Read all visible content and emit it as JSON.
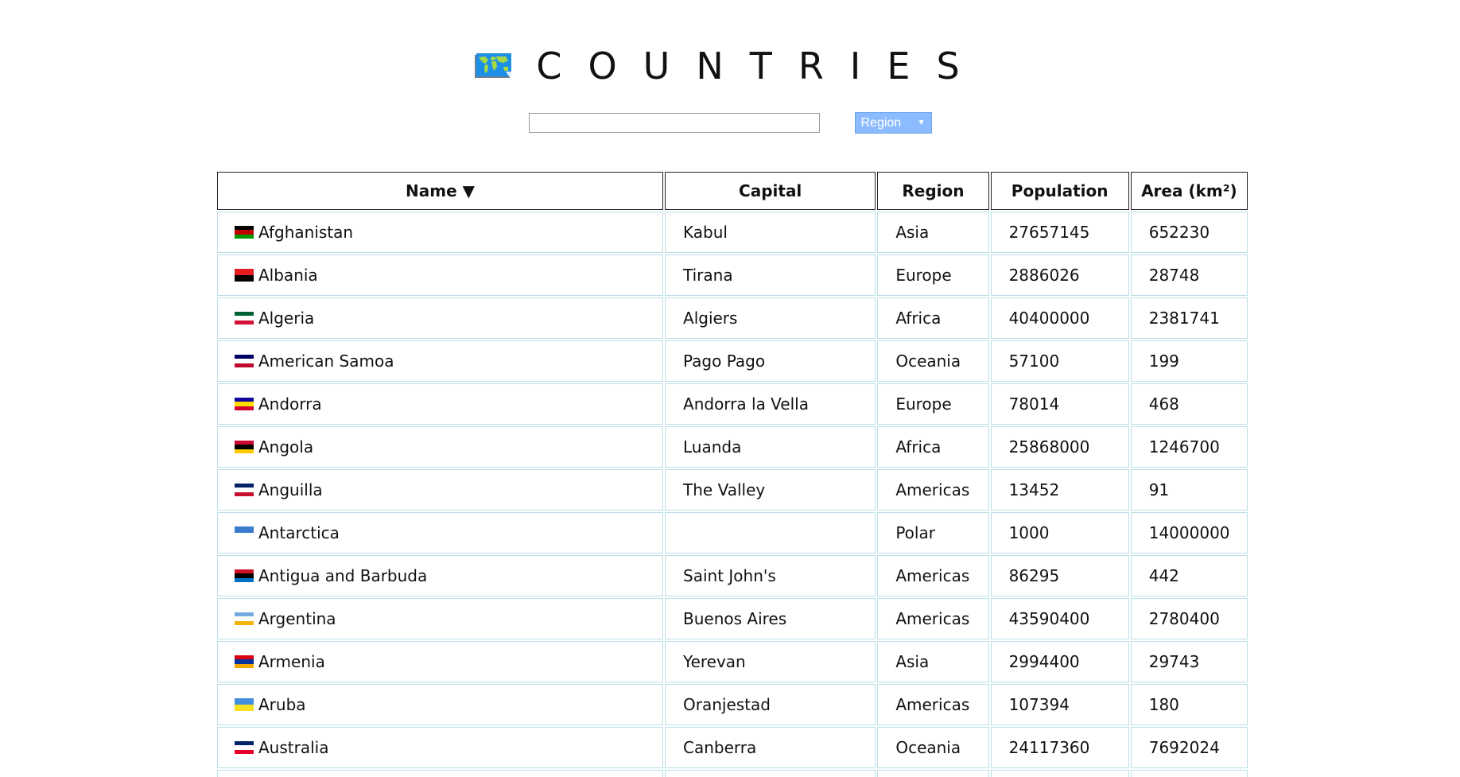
{
  "header": {
    "title": "COUNTRIES",
    "icon": "world-map-icon"
  },
  "controls": {
    "search": {
      "value": "",
      "placeholder": ""
    },
    "region_select": {
      "selected": "Region",
      "icon": "caret-down-icon"
    }
  },
  "table": {
    "columns": [
      {
        "label": "Name ▼",
        "sorted": "descending-indicator"
      },
      {
        "label": "Capital"
      },
      {
        "label": "Region"
      },
      {
        "label": "Population"
      },
      {
        "label": "Area (km²)"
      }
    ],
    "rows": [
      {
        "name": "Afghanistan",
        "capital": "Kabul",
        "region": "Asia",
        "population": "27657145",
        "area": "652230",
        "flag": "afghanistan-flag-icon",
        "flag_colors": [
          "#000000",
          "#be0000",
          "#009900"
        ]
      },
      {
        "name": "Albania",
        "capital": "Tirana",
        "region": "Europe",
        "population": "2886026",
        "area": "28748",
        "flag": "albania-flag-icon",
        "flag_colors": [
          "#e41e20",
          "#000000"
        ]
      },
      {
        "name": "Algeria",
        "capital": "Algiers",
        "region": "Africa",
        "population": "40400000",
        "area": "2381741",
        "flag": "algeria-flag-icon",
        "flag_colors": [
          "#006233",
          "#ffffff",
          "#d21034"
        ]
      },
      {
        "name": "American Samoa",
        "capital": "Pago Pago",
        "region": "Oceania",
        "population": "57100",
        "area": "199",
        "flag": "american-samoa-flag-icon",
        "flag_colors": [
          "#000066",
          "#ffffff",
          "#bf0a30"
        ]
      },
      {
        "name": "Andorra",
        "capital": "Andorra la Vella",
        "region": "Europe",
        "population": "78014",
        "area": "468",
        "flag": "andorra-flag-icon",
        "flag_colors": [
          "#10069f",
          "#fedd00",
          "#d50032"
        ]
      },
      {
        "name": "Angola",
        "capital": "Luanda",
        "region": "Africa",
        "population": "25868000",
        "area": "1246700",
        "flag": "angola-flag-icon",
        "flag_colors": [
          "#cc092f",
          "#000000",
          "#ffcb00"
        ]
      },
      {
        "name": "Anguilla",
        "capital": "The Valley",
        "region": "Americas",
        "population": "13452",
        "area": "91",
        "flag": "anguilla-flag-icon",
        "flag_colors": [
          "#012169",
          "#ffffff",
          "#c8102e"
        ]
      },
      {
        "name": "Antarctica",
        "capital": "",
        "region": "Polar",
        "population": "1000",
        "area": "14000000",
        "flag": "antarctica-flag-icon",
        "flag_colors": [
          "#3a7dce",
          "#ffffff"
        ]
      },
      {
        "name": "Antigua and Barbuda",
        "capital": "Saint John's",
        "region": "Americas",
        "population": "86295",
        "area": "442",
        "flag": "antigua-and-barbuda-flag-icon",
        "flag_colors": [
          "#ce1126",
          "#000000",
          "#0072c6"
        ]
      },
      {
        "name": "Argentina",
        "capital": "Buenos Aires",
        "region": "Americas",
        "population": "43590400",
        "area": "2780400",
        "flag": "argentina-flag-icon",
        "flag_colors": [
          "#74acdf",
          "#ffffff",
          "#f6b40e"
        ]
      },
      {
        "name": "Armenia",
        "capital": "Yerevan",
        "region": "Asia",
        "population": "2994400",
        "area": "29743",
        "flag": "armenia-flag-icon",
        "flag_colors": [
          "#d90012",
          "#0033a0",
          "#f2a800"
        ]
      },
      {
        "name": "Aruba",
        "capital": "Oranjestad",
        "region": "Americas",
        "population": "107394",
        "area": "180",
        "flag": "aruba-flag-icon",
        "flag_colors": [
          "#418fde",
          "#fbe122"
        ]
      },
      {
        "name": "Australia",
        "capital": "Canberra",
        "region": "Oceania",
        "population": "24117360",
        "area": "7692024",
        "flag": "australia-flag-icon",
        "flag_colors": [
          "#012169",
          "#ffffff",
          "#e4002b"
        ]
      },
      {
        "name": "",
        "capital": "",
        "region": "",
        "population": "",
        "area": "",
        "flag": "",
        "flag_colors": [
          "#ffffff",
          "#ffffff"
        ]
      }
    ]
  },
  "colors": {
    "header_border": "#222222",
    "cell_border": "#b9dfe8",
    "select_bg": "#8cbcff"
  }
}
